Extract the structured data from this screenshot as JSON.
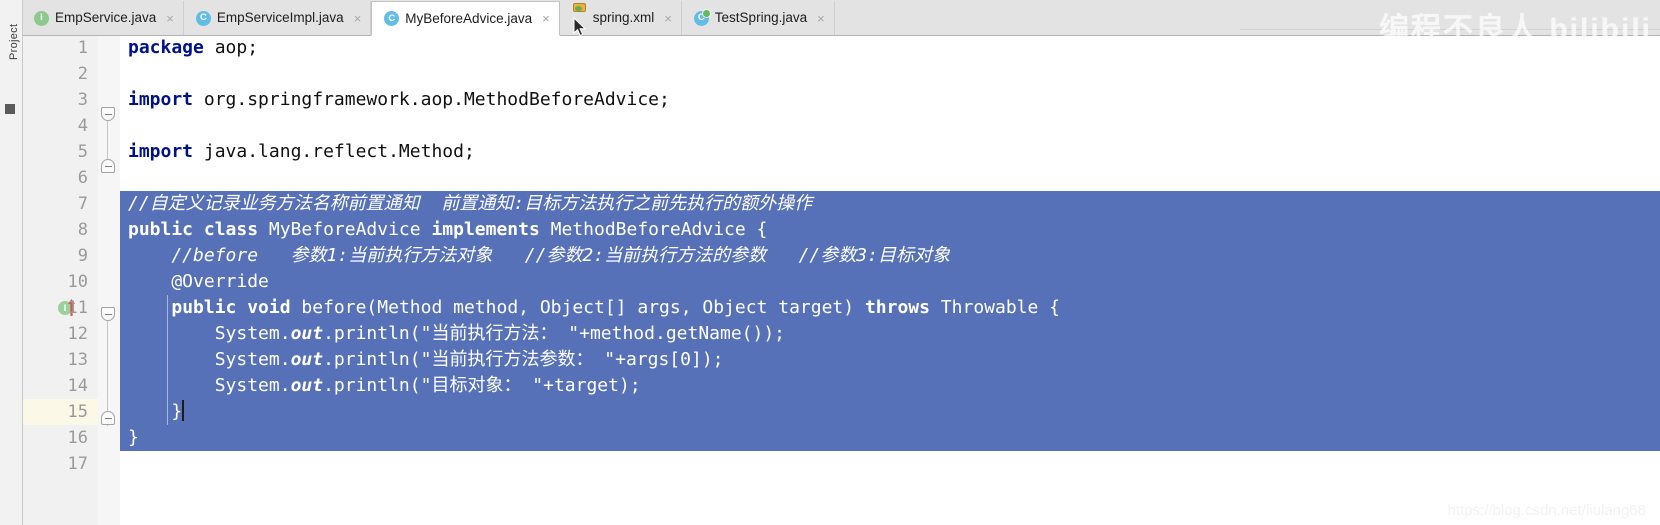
{
  "app": {
    "type": "java-ide-editor",
    "selection_color": "#5671b7",
    "keyword_color": "#00128a",
    "gutter_bg": "#f1f1f1"
  },
  "tool_strip": {
    "label": "Project"
  },
  "tabs": [
    {
      "label": "EmpService.java",
      "icon": "java-interface-icon",
      "icon_letter": "I",
      "active": false,
      "close": "×"
    },
    {
      "label": "EmpServiceImpl.java",
      "icon": "java-class-icon",
      "icon_letter": "C",
      "active": false,
      "close": "×"
    },
    {
      "label": "MyBeforeAdvice.java",
      "icon": "java-class-icon",
      "icon_letter": "C",
      "active": true,
      "close": "×"
    },
    {
      "label": "spring.xml",
      "icon": "spring-xml-file-icon",
      "icon_letter": "",
      "active": false,
      "close": "×"
    },
    {
      "label": "TestSpring.java",
      "icon": "java-class-runnable-icon",
      "icon_letter": "C",
      "active": false,
      "close": "×"
    }
  ],
  "gutter": {
    "line_numbers": [
      "1",
      "2",
      "3",
      "4",
      "5",
      "6",
      "7",
      "8",
      "9",
      "10",
      "11",
      "12",
      "13",
      "14",
      "15",
      "16",
      "17"
    ],
    "caret_line": 15,
    "marker_line": 11,
    "marker_icon": "implementing-method-icon",
    "marker_letter": "I",
    "marker_arrow": "override-arrow-icon"
  },
  "code": {
    "language": "java",
    "lines": [
      {
        "n": 1,
        "selected": false,
        "segs": [
          {
            "t": "package",
            "s": "kw"
          },
          {
            "t": " aop;",
            "s": ""
          }
        ]
      },
      {
        "n": 2,
        "selected": false,
        "segs": []
      },
      {
        "n": 3,
        "selected": false,
        "segs": [
          {
            "t": "import",
            "s": "kw"
          },
          {
            "t": " org.springframework.aop.MethodBeforeAdvice;",
            "s": ""
          }
        ]
      },
      {
        "n": 4,
        "selected": false,
        "segs": []
      },
      {
        "n": 5,
        "selected": false,
        "segs": [
          {
            "t": "import",
            "s": "kw"
          },
          {
            "t": " java.lang.reflect.Method;",
            "s": ""
          }
        ]
      },
      {
        "n": 6,
        "selected": false,
        "segs": []
      },
      {
        "n": 7,
        "selected": true,
        "segs": [
          {
            "t": "//自定义记录业务方法名称前置通知  前置通知:目标方法执行之前先执行的额外操作",
            "s": "it"
          }
        ]
      },
      {
        "n": 8,
        "selected": true,
        "segs": [
          {
            "t": "public class",
            "s": "bold"
          },
          {
            "t": " MyBeforeAdvice ",
            "s": ""
          },
          {
            "t": "implements",
            "s": "bold"
          },
          {
            "t": " MethodBeforeAdvice {",
            "s": ""
          }
        ]
      },
      {
        "n": 9,
        "selected": true,
        "segs": [
          {
            "t": "    //before   参数1:当前执行方法对象   //参数2:当前执行方法的参数   //参数3:目标对象",
            "s": "it"
          }
        ]
      },
      {
        "n": 10,
        "selected": true,
        "segs": [
          {
            "t": "    @Override",
            "s": ""
          }
        ]
      },
      {
        "n": 11,
        "selected": true,
        "segs": [
          {
            "t": "    ",
            "s": ""
          },
          {
            "t": "public void",
            "s": "bold"
          },
          {
            "t": " before(Method method, Object[] args, Object target) ",
            "s": ""
          },
          {
            "t": "throws",
            "s": "bold"
          },
          {
            "t": " Throwable {",
            "s": ""
          }
        ]
      },
      {
        "n": 12,
        "selected": true,
        "segs": [
          {
            "t": "        System.",
            "s": ""
          },
          {
            "t": "out",
            "s": "bi"
          },
          {
            "t": ".println(\"当前执行方法： \"+method.getName());",
            "s": ""
          }
        ]
      },
      {
        "n": 13,
        "selected": true,
        "segs": [
          {
            "t": "        System.",
            "s": ""
          },
          {
            "t": "out",
            "s": "bi"
          },
          {
            "t": ".println(\"当前执行方法参数： \"+args[0]);",
            "s": ""
          }
        ]
      },
      {
        "n": 14,
        "selected": true,
        "segs": [
          {
            "t": "        System.",
            "s": ""
          },
          {
            "t": "out",
            "s": "bi"
          },
          {
            "t": ".println(\"目标对象： \"+target);",
            "s": ""
          }
        ]
      },
      {
        "n": 15,
        "selected": true,
        "segs": [
          {
            "t": "    }",
            "s": ""
          }
        ],
        "caret": true
      },
      {
        "n": 16,
        "selected": true,
        "segs": [
          {
            "t": "}",
            "s": ""
          }
        ]
      },
      {
        "n": 17,
        "selected": false,
        "segs": []
      }
    ]
  },
  "watermarks": {
    "top": "编程不良人   bilibili",
    "bottom": "https://blog.csdn.net/liulang68"
  }
}
